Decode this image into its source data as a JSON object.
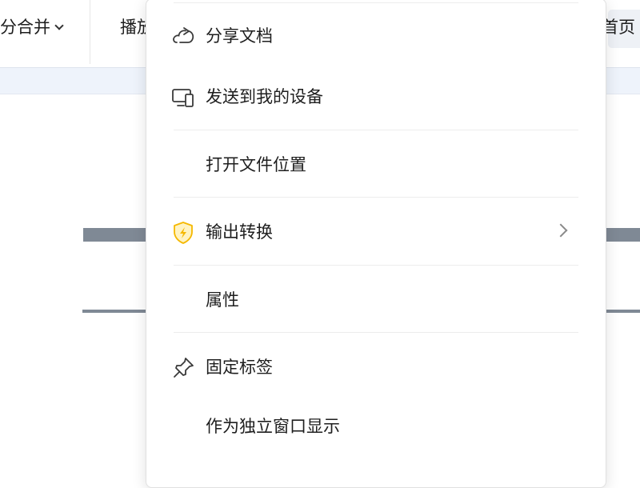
{
  "toolbar": {
    "merge_label": "分合并",
    "play_label": "播放",
    "home_label": "首页"
  },
  "menu": {
    "items": [
      {
        "label": "分享文档",
        "icon": "share-cloud-icon"
      },
      {
        "label": "发送到我的设备",
        "icon": "send-to-device-icon"
      },
      {
        "label": "打开文件位置"
      },
      {
        "label": "输出转换",
        "icon": "convert-coin-icon",
        "has_submenu": true
      },
      {
        "label": "属性"
      },
      {
        "label": "固定标签",
        "icon": "pin-icon"
      },
      {
        "label": "作为独立窗口显示"
      }
    ]
  },
  "colors": {
    "accent_convert": "#f5b800",
    "icon_stroke": "#3a3a3a",
    "ribbon_bg": "#eef3fb",
    "doc_rule": "#7f8995"
  }
}
